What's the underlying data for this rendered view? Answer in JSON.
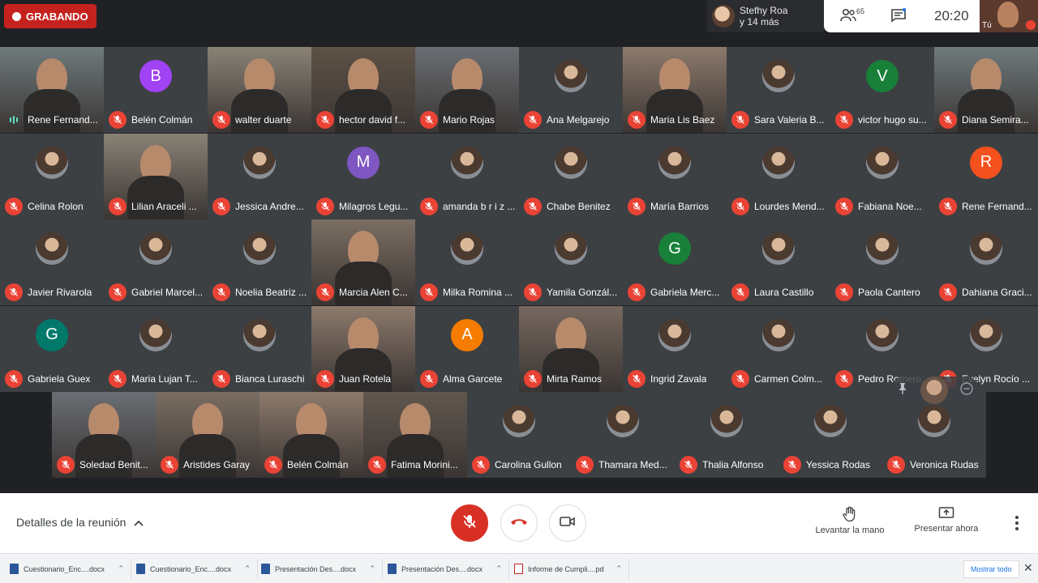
{
  "recording": {
    "label": "GRABANDO"
  },
  "speaker_chip": {
    "line1": "Stefhy Roa",
    "line2": "y 14 más"
  },
  "status": {
    "participants_count": "65",
    "time": "20:20"
  },
  "self_view": {
    "label": "Tú"
  },
  "participants": [
    {
      "name": "Rene Fernand...",
      "kind": "video",
      "speaking": true
    },
    {
      "name": "Belén Colmán",
      "kind": "initial",
      "initial": "B",
      "color": "#a142f4"
    },
    {
      "name": "walter duarte",
      "kind": "video"
    },
    {
      "name": "hector david f...",
      "kind": "video"
    },
    {
      "name": "Mario Rojas",
      "kind": "video"
    },
    {
      "name": "Ana Melgarejo",
      "kind": "photo"
    },
    {
      "name": "Maria Lis Baez",
      "kind": "video"
    },
    {
      "name": "Sara Valeria B...",
      "kind": "photo"
    },
    {
      "name": "victor hugo su...",
      "kind": "initial",
      "initial": "V",
      "color": "#188038"
    },
    {
      "name": "Diana Semira...",
      "kind": "video"
    },
    {
      "name": "Celina Rolon",
      "kind": "photo"
    },
    {
      "name": "Lilian Araceli ...",
      "kind": "video"
    },
    {
      "name": "Jessica Andre...",
      "kind": "photo"
    },
    {
      "name": "Milagros Legu...",
      "kind": "initial",
      "initial": "M",
      "color": "#7e57c2"
    },
    {
      "name": "amanda b r i z ...",
      "kind": "photo"
    },
    {
      "name": "Chabe Benitez",
      "kind": "photo"
    },
    {
      "name": "María Barrios",
      "kind": "photo"
    },
    {
      "name": "Lourdes Mend...",
      "kind": "photo"
    },
    {
      "name": "Fabiana Noe...",
      "kind": "photo"
    },
    {
      "name": "Rene Fernand...",
      "kind": "initial",
      "initial": "R",
      "color": "#f4511e"
    },
    {
      "name": "Javier Rivarola",
      "kind": "photo"
    },
    {
      "name": "Gabriel Marcel...",
      "kind": "photo"
    },
    {
      "name": "Noelia Beatriz ...",
      "kind": "photo"
    },
    {
      "name": "Marcia Alen C...",
      "kind": "video"
    },
    {
      "name": "Milka Romina ...",
      "kind": "photo"
    },
    {
      "name": "Yamila Gonzál...",
      "kind": "photo"
    },
    {
      "name": "Gabriela Merc...",
      "kind": "initial",
      "initial": "G",
      "color": "#188038"
    },
    {
      "name": "Laura Castillo",
      "kind": "photo"
    },
    {
      "name": "Paola Cantero",
      "kind": "photo"
    },
    {
      "name": "Dahiana Graci...",
      "kind": "photo"
    },
    {
      "name": "Gabriela Guex",
      "kind": "initial",
      "initial": "G",
      "color": "#00796b"
    },
    {
      "name": "Maria Lujan T...",
      "kind": "photo"
    },
    {
      "name": "Bianca Luraschi",
      "kind": "photo"
    },
    {
      "name": "Juan Rotela",
      "kind": "video"
    },
    {
      "name": "Alma Garcete",
      "kind": "initial",
      "initial": "A",
      "color": "#f57c00"
    },
    {
      "name": "Mirta Ramos",
      "kind": "video"
    },
    {
      "name": "Ingrid Zavala",
      "kind": "photo"
    },
    {
      "name": "Carmen Colm...",
      "kind": "photo"
    },
    {
      "name": "Pedro Romero...",
      "kind": "photo"
    },
    {
      "name": "Evelyn Rocío ...",
      "kind": "photo"
    },
    {
      "name": "Soledad Benit...",
      "kind": "video"
    },
    {
      "name": "Aristides Garay",
      "kind": "video"
    },
    {
      "name": "Belén Colmán",
      "kind": "video"
    },
    {
      "name": "Fatima Morini...",
      "kind": "video"
    },
    {
      "name": "Carolina Gullon",
      "kind": "photo"
    },
    {
      "name": "Thamara Med...",
      "kind": "photo"
    },
    {
      "name": "Thalia Alfonso",
      "kind": "photo"
    },
    {
      "name": "Yessica Rodas",
      "kind": "photo"
    },
    {
      "name": "Veronica Rudas",
      "kind": "photo"
    }
  ],
  "bottom": {
    "details_label": "Detalles de la reunión",
    "raise_hand": "Levantar la mano",
    "present_now": "Presentar ahora"
  },
  "downloads": [
    {
      "name": "Cuestionario_Enc....docx",
      "type": "docx"
    },
    {
      "name": "Cuestionario_Enc....docx",
      "type": "docx"
    },
    {
      "name": "Presentación Des....docx",
      "type": "docx"
    },
    {
      "name": "Presentación Des....docx",
      "type": "docx"
    },
    {
      "name": "Informe de Cumpli....pdf",
      "type": "pdf"
    }
  ],
  "downloads_show_all": "Mostrar todo",
  "colors": {
    "mute_red": "#ea4335",
    "recording_red": "#c5221f",
    "active_outline": "#5fe3c7"
  }
}
